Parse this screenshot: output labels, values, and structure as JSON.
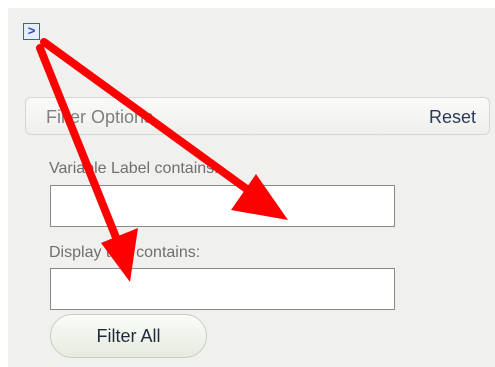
{
  "sidebar": {
    "expand_glyph": ">"
  },
  "filter_panel": {
    "title": "Filter Options",
    "reset_label": "Reset",
    "variable_label_caption": "Variable Label contains:",
    "variable_label_value": "",
    "display_text_caption": "Display text contains:",
    "display_text_value": "",
    "filter_all_label": "Filter All"
  },
  "annotation": {
    "arrow_color": "#ff0000"
  }
}
